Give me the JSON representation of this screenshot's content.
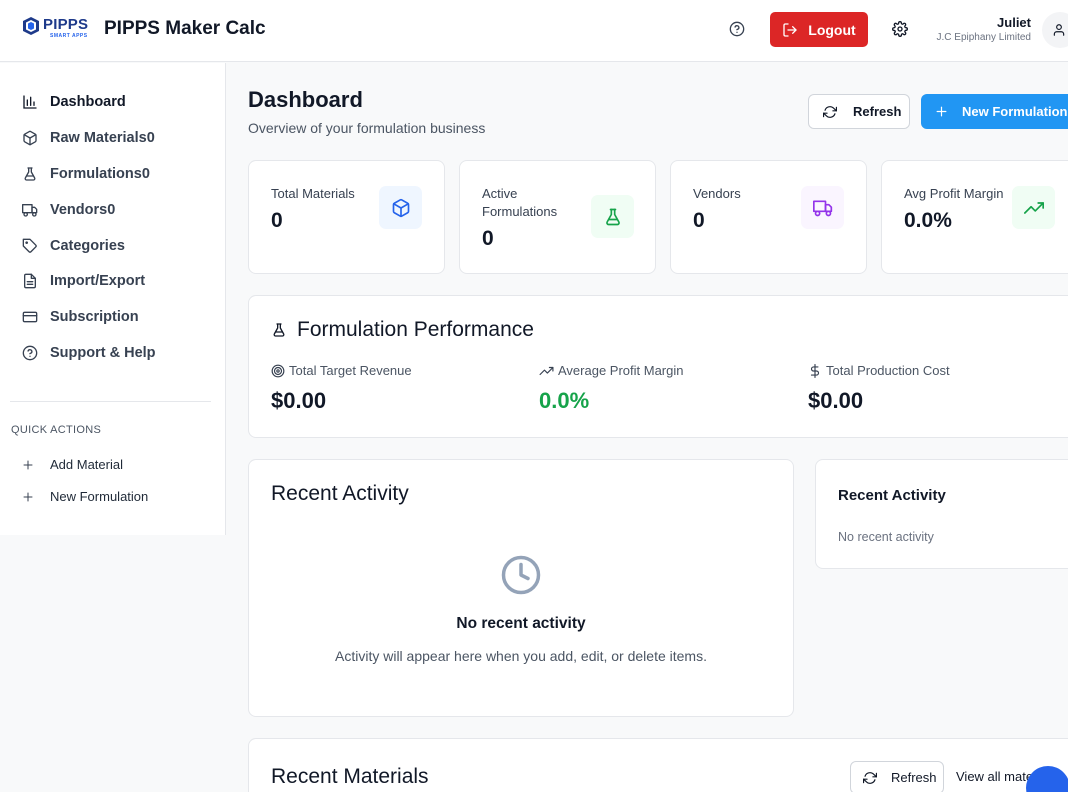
{
  "header": {
    "logo_text": "PIPPS",
    "logo_subtext": "SMART APPS",
    "app_title": "PIPPS Maker Calc",
    "logout_label": "Logout",
    "user_name": "Juliet",
    "user_org": "J.C Epiphany Limited"
  },
  "sidebar": {
    "items": [
      {
        "label": "Dashboard",
        "icon": "bar-chart-icon"
      },
      {
        "label": "Raw Materials0",
        "icon": "package-icon"
      },
      {
        "label": "Formulations0",
        "icon": "flask-icon"
      },
      {
        "label": "Vendors0",
        "icon": "truck-icon"
      },
      {
        "label": "Categories",
        "icon": "tag-icon"
      },
      {
        "label": "Import/Export",
        "icon": "file-icon"
      },
      {
        "label": "Subscription",
        "icon": "credit-card-icon"
      },
      {
        "label": "Support & Help",
        "icon": "help-circle-icon"
      }
    ],
    "quick_actions_title": "QUICK ACTIONS",
    "quick_actions": [
      {
        "label": "Add Material"
      },
      {
        "label": "New Formulation"
      }
    ]
  },
  "main": {
    "title": "Dashboard",
    "subtitle": "Overview of your formulation business",
    "refresh_label": "Refresh",
    "new_formulation_label": "New Formulation",
    "stats": [
      {
        "label": "Total Materials",
        "value": "0",
        "icon": "package-icon",
        "color": "#2563eb",
        "bg": "#eff6ff"
      },
      {
        "label": "Active Formulations",
        "value": "0",
        "icon": "flask-icon",
        "color": "#16a34a",
        "bg": "#f0fdf4"
      },
      {
        "label": "Vendors",
        "value": "0",
        "icon": "truck-icon",
        "color": "#9333ea",
        "bg": "#faf5ff"
      },
      {
        "label": "Avg Profit Margin",
        "value": "0.0%",
        "icon": "trending-up-icon",
        "color": "#16a34a",
        "bg": "#f0fdf4"
      }
    ],
    "performance": {
      "title": "Formulation Performance",
      "metrics": [
        {
          "label": "Total Target Revenue",
          "value": "$0.00",
          "icon": "target-icon",
          "color": "#111827"
        },
        {
          "label": "Average Profit Margin",
          "value": "0.0%",
          "icon": "trending-up-icon",
          "color": "#16a34a"
        },
        {
          "label": "Total Production Cost",
          "value": "$0.00",
          "icon": "dollar-icon",
          "color": "#111827"
        }
      ]
    },
    "recent_activity": {
      "title": "Recent Activity",
      "empty_title": "No recent activity",
      "empty_text": "Activity will appear here when you add, edit, or delete items."
    },
    "recent_activity_side": {
      "title": "Recent Activity",
      "text": "No recent activity"
    },
    "recent_materials": {
      "title": "Recent Materials",
      "refresh_label": "Refresh",
      "view_all_label": "View all mate"
    }
  }
}
